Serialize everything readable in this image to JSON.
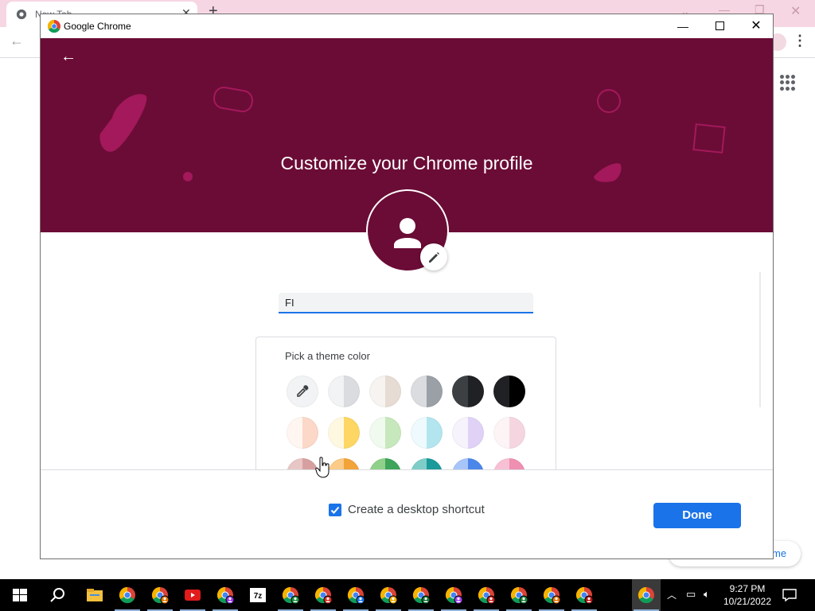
{
  "browser": {
    "tab_title": "New Tab",
    "customize_label": "me"
  },
  "window": {
    "title": "Google Chrome"
  },
  "profile": {
    "heading": "Customize your Chrome profile",
    "name_value": "FI",
    "theme_heading": "Pick a theme color",
    "banner_color": "#6b0c36",
    "themes_row1": [
      {
        "name": "color-picker",
        "left": "#f1f3f4",
        "right": "#f1f3f4"
      },
      {
        "name": "grey-light",
        "left": "#f1f3f4",
        "right": "#dadce0"
      },
      {
        "name": "beige",
        "left": "#f6f3f0",
        "right": "#e6dcd3"
      },
      {
        "name": "grey",
        "left": "#dadce0",
        "right": "#9aa0a6"
      },
      {
        "name": "slate",
        "left": "#3c4043",
        "right": "#202124"
      },
      {
        "name": "black",
        "left": "#202124",
        "right": "#000000"
      }
    ],
    "themes_row2": [
      {
        "name": "peach",
        "left": "#fff6f1",
        "right": "#fbd8c8"
      },
      {
        "name": "yellow",
        "left": "#fff8e1",
        "right": "#fdd663"
      },
      {
        "name": "green-light",
        "left": "#f1faef",
        "right": "#c7e7bd"
      },
      {
        "name": "cyan-light",
        "left": "#eefafd",
        "right": "#b3e5ef"
      },
      {
        "name": "lavender",
        "left": "#f7f3fd",
        "right": "#e0d2f7"
      },
      {
        "name": "pink-light",
        "left": "#fdf4f6",
        "right": "#f5d6e0"
      }
    ],
    "themes_row3": [
      {
        "name": "rose",
        "left": "#e9c6c6",
        "right": "#d7a0a0"
      },
      {
        "name": "orange",
        "left": "#fbcb87",
        "right": "#f2a33a"
      },
      {
        "name": "green",
        "left": "#8fd18a",
        "right": "#3ea45a"
      },
      {
        "name": "teal",
        "left": "#7fcdc8",
        "right": "#1a9a9a"
      },
      {
        "name": "blue",
        "left": "#a7c5f9",
        "right": "#4c86ea"
      },
      {
        "name": "pink",
        "left": "#f8c1d3",
        "right": "#ef8fb1"
      }
    ],
    "shortcut_label": "Create a desktop shortcut",
    "shortcut_checked": true,
    "done_label": "Done"
  },
  "taskbar": {
    "time": "9:27 PM",
    "date": "10/21/2022",
    "apps": [
      "file-explorer",
      "chrome",
      "chrome-profile-1",
      "youtube",
      "chrome-profile-2",
      "7zip",
      "chrome-profile-3",
      "chrome-profile-4",
      "chrome-profile-5",
      "chrome-profile-6",
      "chrome-profile-7",
      "chrome-profile-8",
      "chrome-profile-9",
      "chrome-profile-10",
      "chrome-profile-11",
      "chrome-profile-12",
      "chrome-active"
    ]
  }
}
